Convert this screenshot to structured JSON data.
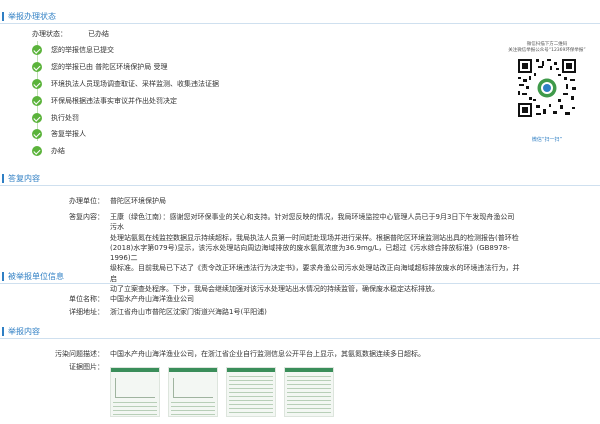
{
  "sections": {
    "status": "举报办理状态",
    "reply": "答复内容",
    "reported_unit": "被举报单位信息",
    "report_content": "举报内容"
  },
  "status": {
    "label": "办理状态：",
    "value": "已办结"
  },
  "steps": [
    "您的举报信息已提交",
    "您的举报已由 普陀区环境保护局 受理",
    "环境执法人员现场调查取证、采样监测、收集违法证据",
    "环保局根据违法事实审议并作出处罚决定",
    "执行处罚",
    "答复举报人",
    "办结"
  ],
  "qr": {
    "line1": "微信扫描下方二维码",
    "line2": "关注微信举报公众号“12369环保举报”",
    "caption": "微信“扫一扫”"
  },
  "reply": {
    "unit_label": "办理单位：",
    "unit_value": "普陀区环境保护局",
    "content_label": "答复内容：",
    "content_value": "王康（绿色江南）：感谢您对环保事业的关心和支持。针对您反映的情况，我局环境监控中心管理人员已于9月3日下午发现舟渔公司污水\n处理站氨氮在线监控数据显示持续超标，我局执法人员第一时间赶赴现场并进行采样。根据普陀区环境监测站出具的检测报告(普环检\n(2018)水字第079号)显示，该污水处理站向周边海域排放的废水氨氮浓度为36.9mg/L，已超过《污水综合排放标准》(GB8978-1996)二\n级标准。目前我局已下达了《责令改正环境违法行为决定书》，要求舟渔公司污水处理站改正向海域超标排放废水的环境违法行为，并启\n动了立案查处程序。下步，我局会继续加强对该污水处理站出水情况的持续监管，确保废水稳定达标排放。"
  },
  "reported_unit": {
    "name_label": "单位名称：",
    "name_value": "中国水产舟山海洋渔业公司",
    "addr_label": "详细地址：",
    "addr_value": "浙江省舟山市普陀区沈家门街道兴海路1号(平阳浦)"
  },
  "report_content": {
    "issue_label": "污染问题描述：",
    "issue_value": "中国水产舟山海洋渔业公司，在浙江省企业自行监测信息公开平台上显示，其氨氮数据连续多日超标。",
    "evidence_label": "证据图片："
  },
  "colors": {
    "accent": "#2f7fc4",
    "check": "#5bb33b"
  }
}
